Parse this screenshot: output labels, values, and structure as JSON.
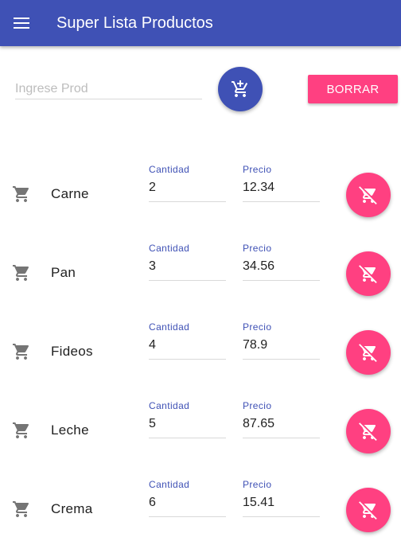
{
  "app": {
    "title": "Super Lista Productos",
    "primary_color": "#3f51b5",
    "accent_color": "#ff4081"
  },
  "entry": {
    "placeholder": "Ingrese Prod",
    "value": "",
    "add_icon": "add-shopping-cart-icon",
    "clear_label": "BORRAR"
  },
  "labels": {
    "quantity": "Cantidad",
    "price": "Precio"
  },
  "products": [
    {
      "name": "Carne",
      "quantity": "2",
      "price": "12.34"
    },
    {
      "name": "Pan",
      "quantity": "3",
      "price": "34.56"
    },
    {
      "name": "Fideos",
      "quantity": "4",
      "price": "78.9"
    },
    {
      "name": "Leche",
      "quantity": "5",
      "price": "87.65"
    },
    {
      "name": "Crema",
      "quantity": "6",
      "price": "15.41"
    }
  ],
  "icons": {
    "row_icon": "shopping-cart-icon",
    "delete_icon": "remove-shopping-cart-icon",
    "menu_icon": "menu-icon"
  }
}
